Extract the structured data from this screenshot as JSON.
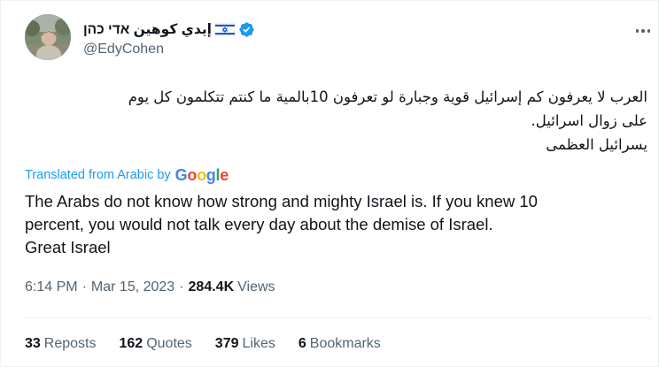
{
  "author": {
    "display_name": "إيدي كوهين אדי כהן",
    "handle": "@EdyCohen",
    "verified": true,
    "flag_icon": "israel-flag-icon",
    "verified_icon": "verified-badge-icon"
  },
  "menu_icon": "more-options-icon",
  "tweet": {
    "original_lines": [
      "العرب لا يعرفون كم إسرائيل قوية وجبارة لو تعرفون 10بالمية ما كنتم تتكلمون كل يوم",
      "على زوال اسرائيل.",
      "يسرائيل العظمى"
    ],
    "translated_label": "Translated from Arabic by",
    "translator_logo": "Google",
    "translation_lines": [
      "The Arabs do not know how strong and mighty Israel is. If you knew 10",
      "percent, you would not talk every day about the demise of Israel.",
      "Great Israel"
    ]
  },
  "meta": {
    "time": "6:14 PM",
    "separator": "·",
    "date": "Mar 15, 2023",
    "views_count": "284.4K",
    "views_label": "Views"
  },
  "stats": {
    "reposts_count": "33",
    "reposts_label": "Reposts",
    "quotes_count": "162",
    "quotes_label": "Quotes",
    "likes_count": "379",
    "likes_label": "Likes",
    "bookmarks_count": "6",
    "bookmarks_label": "Bookmarks"
  },
  "colors": {
    "accent": "#1d9bf0",
    "text_primary": "#0f1419",
    "text_secondary": "#536471",
    "border": "#eff3f4"
  }
}
